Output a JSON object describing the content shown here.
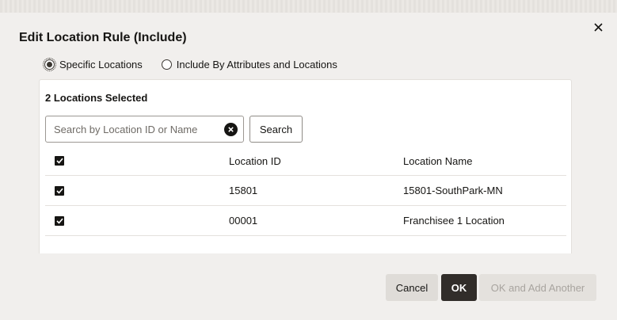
{
  "dialog": {
    "title": "Edit Location Rule (Include)",
    "close_icon": "close-icon"
  },
  "radios": {
    "specific": {
      "label": "Specific Locations",
      "checked": true
    },
    "attributes": {
      "label": "Include By Attributes and Locations",
      "checked": false
    }
  },
  "panel": {
    "selected_count": "2 Locations Selected",
    "search": {
      "placeholder": "Search by Location ID or Name",
      "value": "",
      "button_label": "Search"
    },
    "table": {
      "headers": {
        "id": "Location ID",
        "name": "Location Name"
      },
      "rows": [
        {
          "id": "15801",
          "name": "15801-SouthPark-MN",
          "checked": true
        },
        {
          "id": "00001",
          "name": "Franchisee 1 Location",
          "checked": true
        }
      ]
    }
  },
  "footer": {
    "cancel_label": "Cancel",
    "ok_label": "OK",
    "ok_add_label": "OK and Add Another"
  }
}
